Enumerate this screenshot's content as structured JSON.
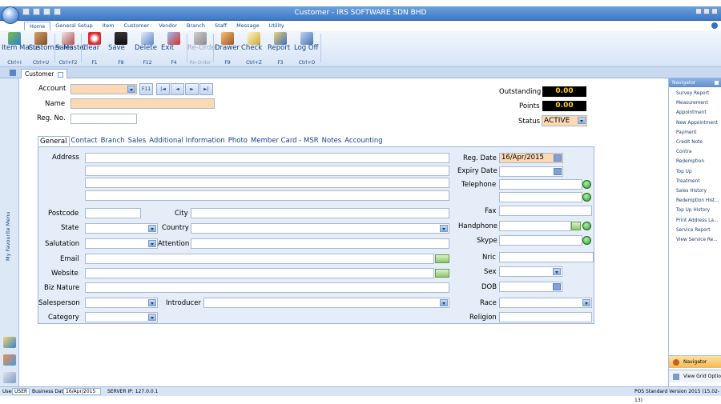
{
  "window": {
    "title": "Customer - IRS SOFTWARE SDN BHD"
  },
  "ribbon_tabs": [
    "Home",
    "General Setup",
    "Item",
    "Customer",
    "Vendor",
    "Branch",
    "Staff",
    "Message",
    "Utility"
  ],
  "ribbon_buttons": [
    {
      "label": "Item Maste",
      "shortcut": "Ctrl+I",
      "icon": "item-master-icon"
    },
    {
      "label": "Customer Master",
      "shortcut": "Ctrl+U",
      "icon": "customer-master-icon"
    },
    {
      "label": "Sales",
      "shortcut": "Ctrl+F2",
      "icon": "sales-icon"
    },
    {
      "label": "Clear",
      "shortcut": "F1",
      "icon": "clear-icon"
    },
    {
      "label": "Save",
      "shortcut": "F8",
      "icon": "save-icon"
    },
    {
      "label": "Delete",
      "shortcut": "F12",
      "icon": "delete-icon"
    },
    {
      "label": "Exit",
      "shortcut": "F4",
      "icon": "exit-icon"
    },
    {
      "label": "Re-Order",
      "shortcut": "Re-Order",
      "icon": "reorder-icon",
      "disabled": true
    },
    {
      "label": "Drawer",
      "shortcut": "F9",
      "icon": "drawer-icon"
    },
    {
      "label": "Check",
      "shortcut": "Ctrl+Z",
      "icon": "check-icon"
    },
    {
      "label": "Report",
      "shortcut": "F3",
      "icon": "report-icon"
    },
    {
      "label": "Log Off",
      "shortcut": "Ctrl+O",
      "icon": "logoff-icon"
    }
  ],
  "doc_tab": "Customer",
  "left_rail_label": "My Favourite Menu",
  "form": {
    "account_label": "Account",
    "f11": "F11",
    "nav_first": "|◄",
    "nav_prev": "◄",
    "nav_next": "►",
    "nav_last": "►|",
    "name_label": "Name",
    "regno_label": "Reg. No.",
    "outstanding_label": "Outstanding",
    "outstanding_value": "0.00",
    "points_label": "Points",
    "points_value": "0.00",
    "status_label": "Status",
    "status_value": "ACTIVE"
  },
  "inner_tabs": [
    "General",
    "Contact",
    "Branch",
    "Sales",
    "Additional Information",
    "Photo",
    "Member Card - MSR",
    "Notes",
    "Accounting"
  ],
  "general": {
    "address": "Address",
    "postcode": "Postcode",
    "city": "City",
    "state": "State",
    "country": "Country",
    "salutation": "Salutation",
    "attention": "Attention",
    "email": "Email",
    "website": "Website",
    "biz_nature": "Biz Nature",
    "salesperson": "Salesperson",
    "introducer": "Introducer",
    "category": "Category",
    "reg_date": "Reg. Date",
    "reg_date_value": "16/Apr/2015",
    "expiry_date": "Expiry Date",
    "telephone": "Telephone",
    "fax": "Fax",
    "handphone": "Handphone",
    "skype": "Skype",
    "nric": "Nric",
    "sex": "Sex",
    "dob": "DOB",
    "race": "Race",
    "religion": "Religion"
  },
  "navigator": {
    "title": "Navigator",
    "items": [
      "Survey Report",
      "Measurement",
      "Appointment",
      "New Appointment",
      "Payment",
      "Credit Note",
      "Contra",
      "Redemption",
      "Top Up",
      "Treatment",
      "Sales History",
      "Redemption Hist...",
      "Top Up History",
      "Print Address La...",
      "Service Report",
      "View Service Re..."
    ],
    "footer_navigator": "Navigator",
    "footer_grid": "View Grid Optio"
  },
  "statusbar": {
    "user_label": "User",
    "user_value": "USER",
    "business_date_label": "Business Date",
    "business_date_value": "16/Apr/2015",
    "server": "SERVER IP: 127.0.0.1",
    "version": "POS Standard Version 2015 (15.02-13)"
  },
  "colors": {
    "accent": "#3f77c4",
    "peach": "#fcd9b5",
    "navigator_active": "#f8b754"
  }
}
